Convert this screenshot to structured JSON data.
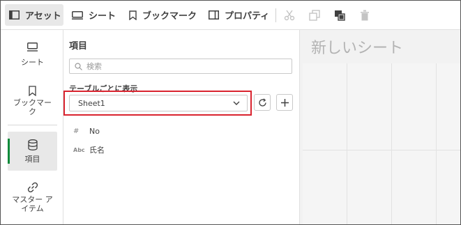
{
  "toolbar": {
    "assets_label": "アセット",
    "sheets_label": "シート",
    "bookmarks_label": "ブックマーク",
    "properties_label": "プロパティ"
  },
  "nav": {
    "items": [
      {
        "label": "シート",
        "icon": "sheet-icon"
      },
      {
        "label": "ブックマーク",
        "icon": "bookmark-icon"
      },
      {
        "label": "項目",
        "icon": "database-icon",
        "active": true
      },
      {
        "label": "マスター アイテム",
        "icon": "link-icon"
      }
    ]
  },
  "panel": {
    "title": "項目",
    "search_placeholder": "検索",
    "group_label": "テーブルごとに表示",
    "selected_table": "Sheet1",
    "fields": [
      {
        "type_icon": "#",
        "name": "No"
      },
      {
        "type_icon": "Abc",
        "name": "氏名"
      }
    ]
  },
  "canvas": {
    "title": "新しいシート"
  },
  "colors": {
    "active_bar": "#0a8a3a",
    "highlight_border": "#d9232e"
  }
}
